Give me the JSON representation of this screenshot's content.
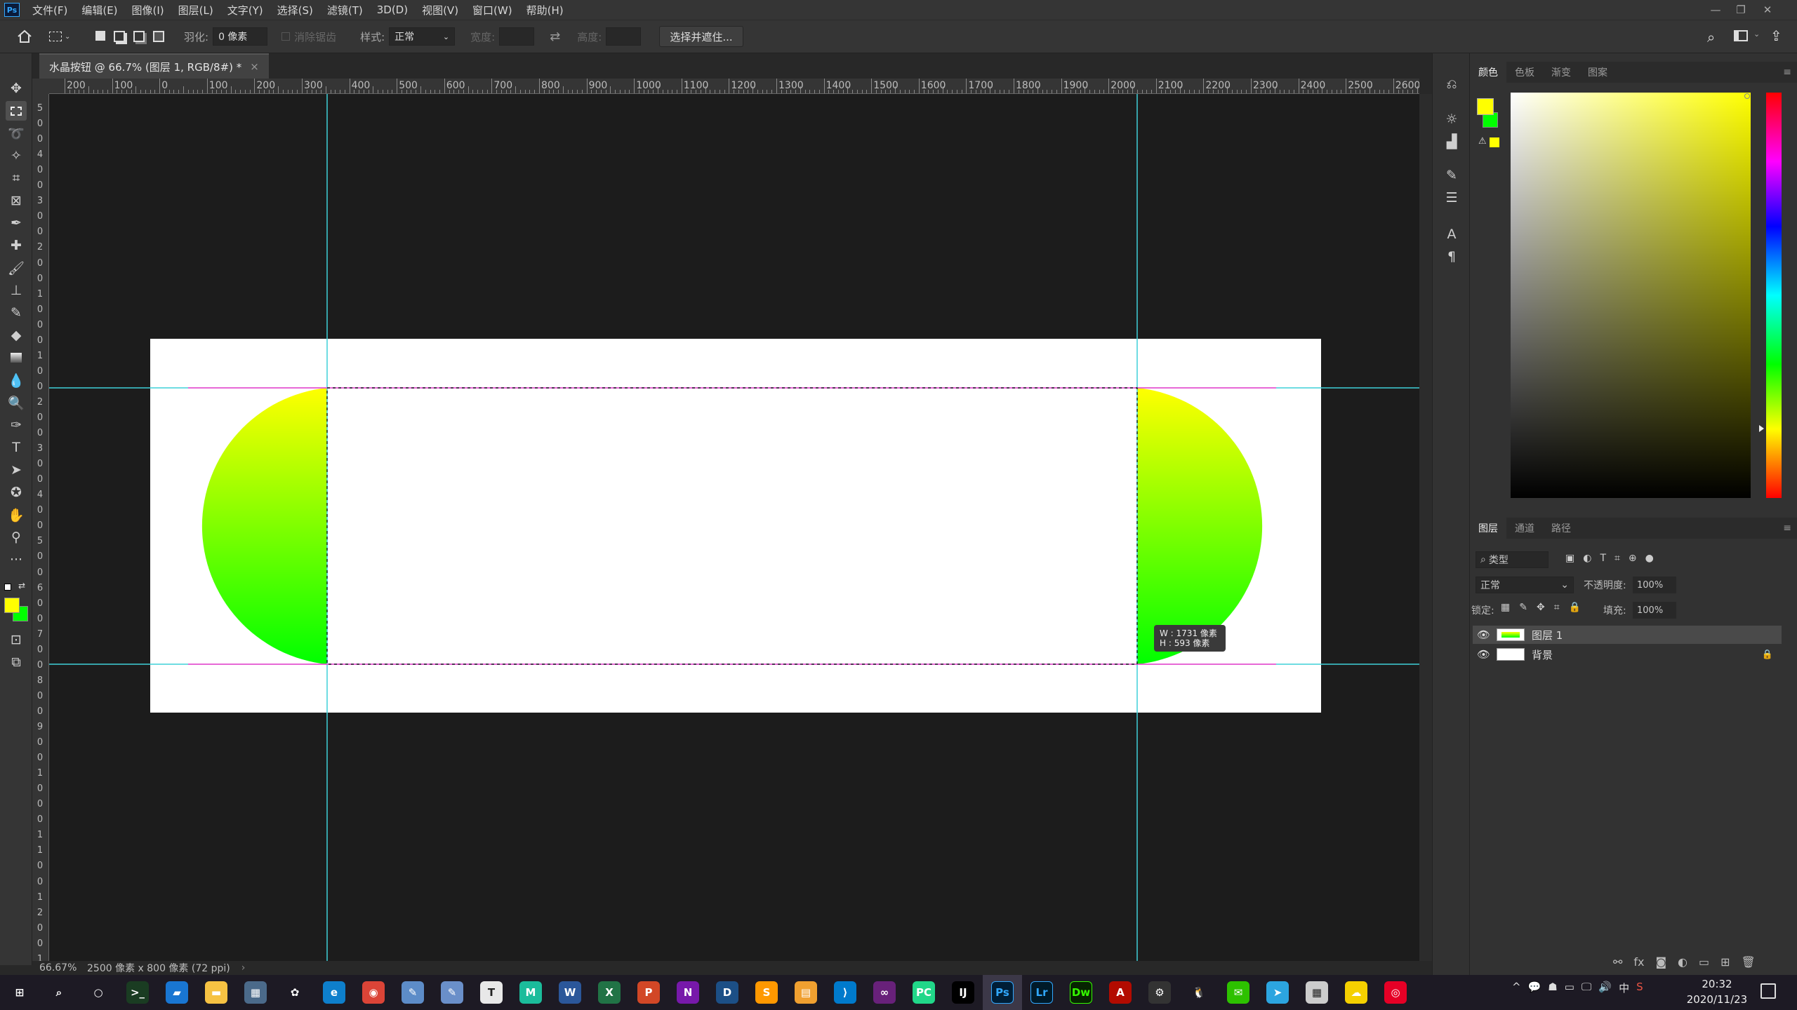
{
  "menubar": {
    "logo": "Ps",
    "items": [
      "文件(F)",
      "编辑(E)",
      "图像(I)",
      "图层(L)",
      "文字(Y)",
      "选择(S)",
      "滤镜(T)",
      "3D(D)",
      "视图(V)",
      "窗口(W)",
      "帮助(H)"
    ]
  },
  "options": {
    "feather_label": "羽化:",
    "feather_value": "0 像素",
    "antialias_label": "消除锯齿",
    "style_label": "样式:",
    "style_value": "正常",
    "width_label": "宽度:",
    "height_label": "高度:",
    "select_mask_button": "选择并遮住..."
  },
  "document": {
    "tab_title": "水晶按钮 @ 66.7% (图层 1, RGB/8#) *",
    "tab_close": "×",
    "zoom": "66.67%",
    "doc_info": "2500 像素 x 800 像素 (72 ppi)"
  },
  "rulers": {
    "top": [
      "200",
      "100",
      "0",
      "100",
      "200",
      "300",
      "400",
      "500",
      "600",
      "700",
      "800",
      "900",
      "1000",
      "1100",
      "1200",
      "1300",
      "1400",
      "1500",
      "1600",
      "1700",
      "1800",
      "1900",
      "2000",
      "2100",
      "2200",
      "2300",
      "2400",
      "2500",
      "2600",
      "2"
    ],
    "left": [
      "5",
      "0",
      "0",
      "4",
      "0",
      "0",
      "3",
      "0",
      "0",
      "2",
      "0",
      "0",
      "1",
      "0",
      "0",
      "0",
      "1",
      "0",
      "0",
      "2",
      "0",
      "0",
      "3",
      "0",
      "0",
      "4",
      "0",
      "0",
      "5",
      "0",
      "0",
      "6",
      "0",
      "0",
      "7",
      "0",
      "0",
      "8",
      "0",
      "0",
      "9",
      "0",
      "0",
      "1",
      "0",
      "0",
      "0",
      "1",
      "1",
      "0",
      "0",
      "1",
      "2",
      "0",
      "0",
      "1"
    ]
  },
  "selection_tooltip": {
    "w": "W : 1731 像素",
    "h": "H :  593 像素"
  },
  "colors": {
    "foreground": "#ffff00",
    "background": "#00ff00",
    "guide": "#3fd0d8",
    "selection_guide": "#ff3fd0"
  },
  "panels": {
    "color_tabs": [
      "颜色",
      "色板",
      "渐变",
      "图案"
    ],
    "layers_tabs": [
      "图层",
      "通道",
      "路径"
    ],
    "filter_kind": "类型",
    "blend_mode": "正常",
    "opacity_label": "不透明度:",
    "opacity_value": "100%",
    "lock_label": "锁定:",
    "fill_label": "填充:",
    "fill_value": "100%",
    "layers": [
      {
        "name": "图层 1",
        "selected": true
      },
      {
        "name": "背景",
        "locked": true
      }
    ]
  },
  "taskbar": {
    "time": "20:32",
    "date": "2020/11/23",
    "ime": "中",
    "apps": [
      "Windows",
      "Search",
      "Cortana",
      "Terminal",
      "Docs",
      "Explorer",
      "Calculator",
      "Settings",
      "Edge",
      "Chrome",
      "Notes",
      "Paint",
      "Typora",
      "Xmind",
      "Word",
      "Excel",
      "PowerPoint",
      "OneNote",
      "Dev",
      "Sublime",
      "Notepad",
      "VS Code",
      "Visual Studio",
      "PyCharm",
      "IntelliJ",
      "Photoshop",
      "Lightroom",
      "Dreamweaver",
      "Acrobat",
      "Tool",
      "QQ",
      "WeChat",
      "Telegram",
      "Store",
      "Cloud",
      "NetEase"
    ]
  }
}
